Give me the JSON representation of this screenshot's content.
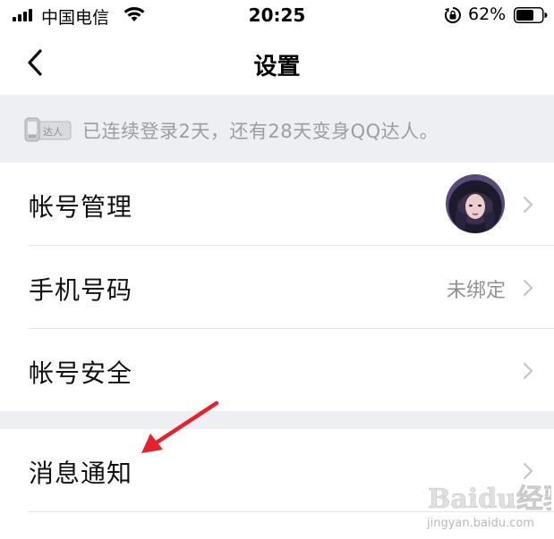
{
  "status_bar": {
    "carrier": "中国电信",
    "time": "20:25",
    "battery_percent": "62%",
    "icons": [
      "signal-icon",
      "wifi-icon",
      "rotation-lock-icon",
      "battery-icon"
    ]
  },
  "nav": {
    "title": "设置",
    "back_icon": "chevron-left-icon"
  },
  "banner": {
    "badge_text": "达人",
    "text": "已连续登录2天，还有28天变身QQ达人。"
  },
  "rows": [
    {
      "label": "帐号管理",
      "value": "",
      "has_avatar": true
    },
    {
      "label": "手机号码",
      "value": "未绑定",
      "has_avatar": false
    },
    {
      "label": "帐号安全",
      "value": "",
      "has_avatar": false
    },
    {
      "label": "消息通知",
      "value": "",
      "has_avatar": false
    }
  ],
  "watermark": {
    "brand": "Baidu经验",
    "url": "jingyan.baidu.com"
  },
  "colors": {
    "background": "#ffffff",
    "section_gap": "#eeeff3",
    "banner_text": "#9b9da3",
    "secondary_text": "#8f9197",
    "arrow": "#e8202a"
  }
}
